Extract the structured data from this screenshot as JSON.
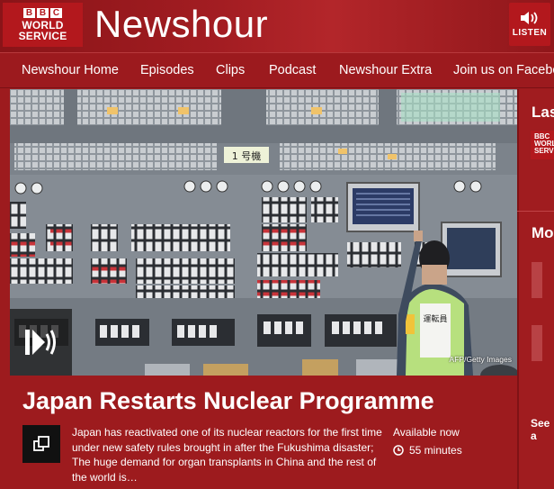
{
  "header": {
    "logo_bbc_letters": [
      "B",
      "B",
      "C"
    ],
    "logo_line1": "WORLD",
    "logo_line2": "SERVICE",
    "title": "Newshour",
    "listen_label": "LISTEN"
  },
  "nav": {
    "items": [
      {
        "label": "Newshour Home"
      },
      {
        "label": "Episodes"
      },
      {
        "label": "Clips"
      },
      {
        "label": "Podcast"
      },
      {
        "label": "Newshour Extra"
      },
      {
        "label": "Join us on Facebook"
      }
    ]
  },
  "hero": {
    "image_credit": "AFP/Getty Images",
    "unit_sign": "1 号機",
    "worker_vest_text": "運転員"
  },
  "story": {
    "title": "Japan Restarts Nuclear Programme",
    "description": "Japan has reactivated one of its nuclear reactors for the first time under new safety rules brought in after the Fukushima disaster; The huge demand for organ transplants in China and the rest of the world is…",
    "availability": "Available now",
    "duration": "55 minutes"
  },
  "sidebar": {
    "latest_heading": "Las",
    "mini_logo_lines": [
      "BBC",
      "WORL",
      "SERV"
    ],
    "more_heading": "Mo",
    "see_all": "See a"
  },
  "colors": {
    "brand_red": "#b3181d",
    "background_red": "#9d1b1e",
    "text": "#ffffff"
  },
  "icons": {
    "listen": "speaker-icon",
    "play": "audio-play-icon",
    "clock": "clock-icon",
    "story": "popout-icon"
  }
}
